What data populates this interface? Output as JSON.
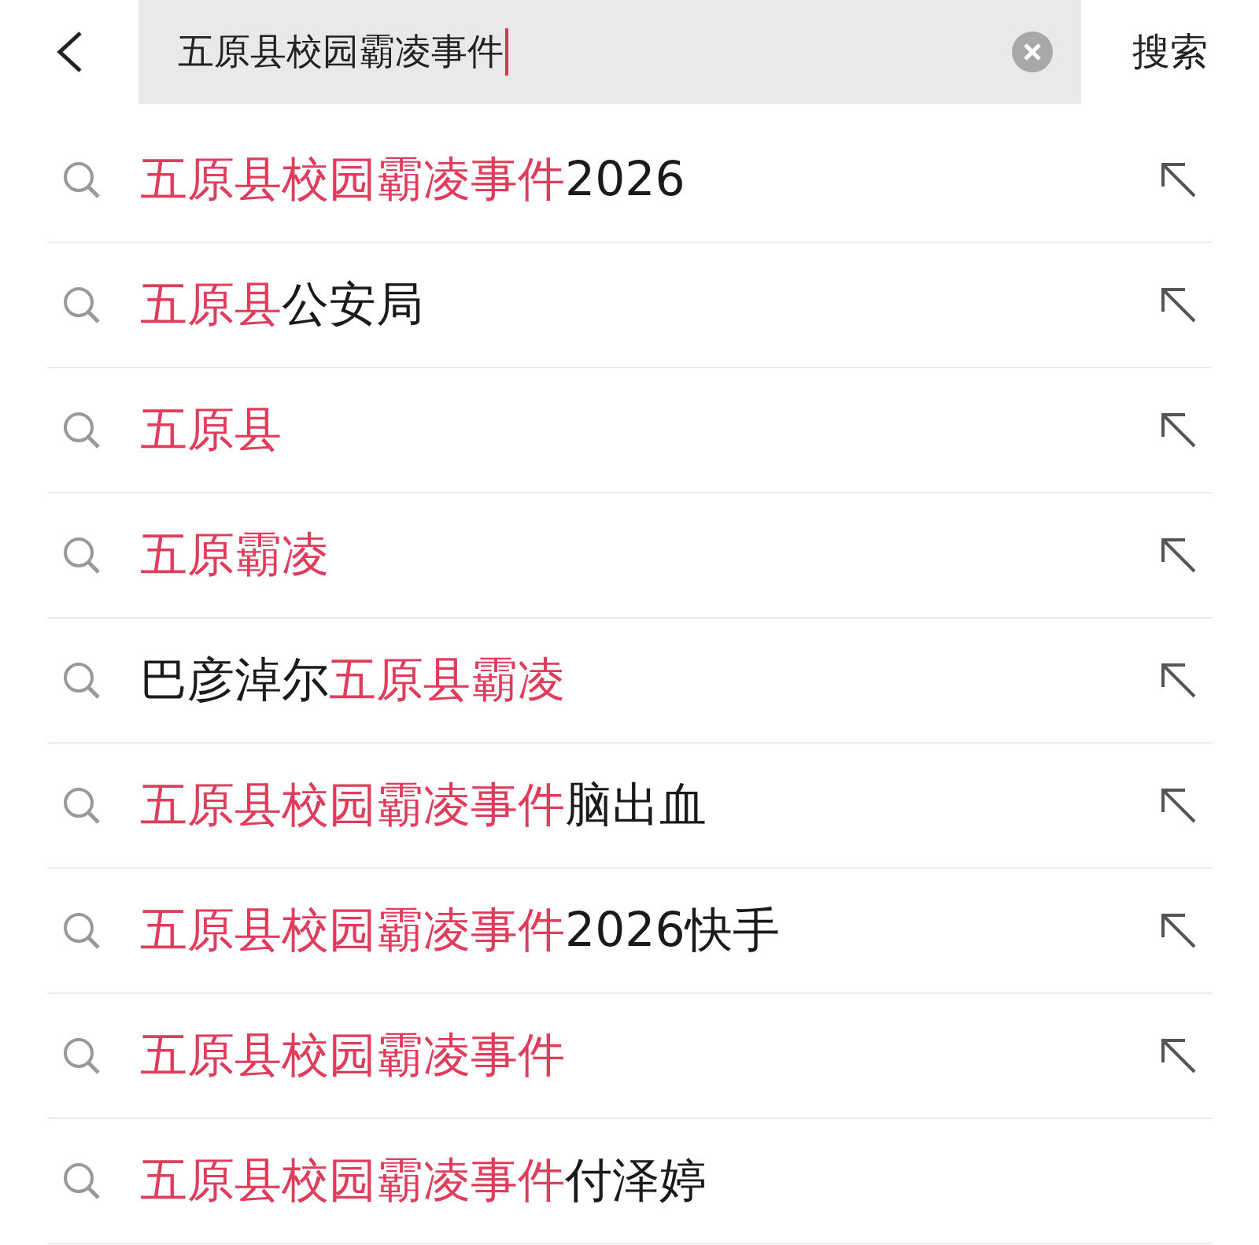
{
  "search": {
    "value": "五原县校园霸凌事件",
    "button": "搜索"
  },
  "suggestions": [
    {
      "segments": [
        {
          "text": "五原县校园霸凌事件",
          "highlight": true
        },
        {
          "text": "2026",
          "highlight": false
        }
      ],
      "arrow": true
    },
    {
      "segments": [
        {
          "text": "五原县",
          "highlight": true
        },
        {
          "text": "公安局",
          "highlight": false
        }
      ],
      "arrow": true
    },
    {
      "segments": [
        {
          "text": "五原县",
          "highlight": true
        }
      ],
      "arrow": true
    },
    {
      "segments": [
        {
          "text": "五原霸凌",
          "highlight": true
        }
      ],
      "arrow": true
    },
    {
      "segments": [
        {
          "text": "巴彦淖尔",
          "highlight": false
        },
        {
          "text": "五原县霸凌",
          "highlight": true
        }
      ],
      "arrow": true
    },
    {
      "segments": [
        {
          "text": "五原县校园霸凌事件",
          "highlight": true
        },
        {
          "text": "脑出血",
          "highlight": false
        }
      ],
      "arrow": true
    },
    {
      "segments": [
        {
          "text": "五原县校园霸凌事件",
          "highlight": true
        },
        {
          "text": "2026快手",
          "highlight": false
        }
      ],
      "arrow": true
    },
    {
      "segments": [
        {
          "text": "五原县校园霸凌事件",
          "highlight": true
        }
      ],
      "arrow": true
    },
    {
      "segments": [
        {
          "text": "五原县校园霸凌事件",
          "highlight": true
        },
        {
          "text": "付泽婷",
          "highlight": false
        }
      ],
      "arrow": false
    }
  ]
}
